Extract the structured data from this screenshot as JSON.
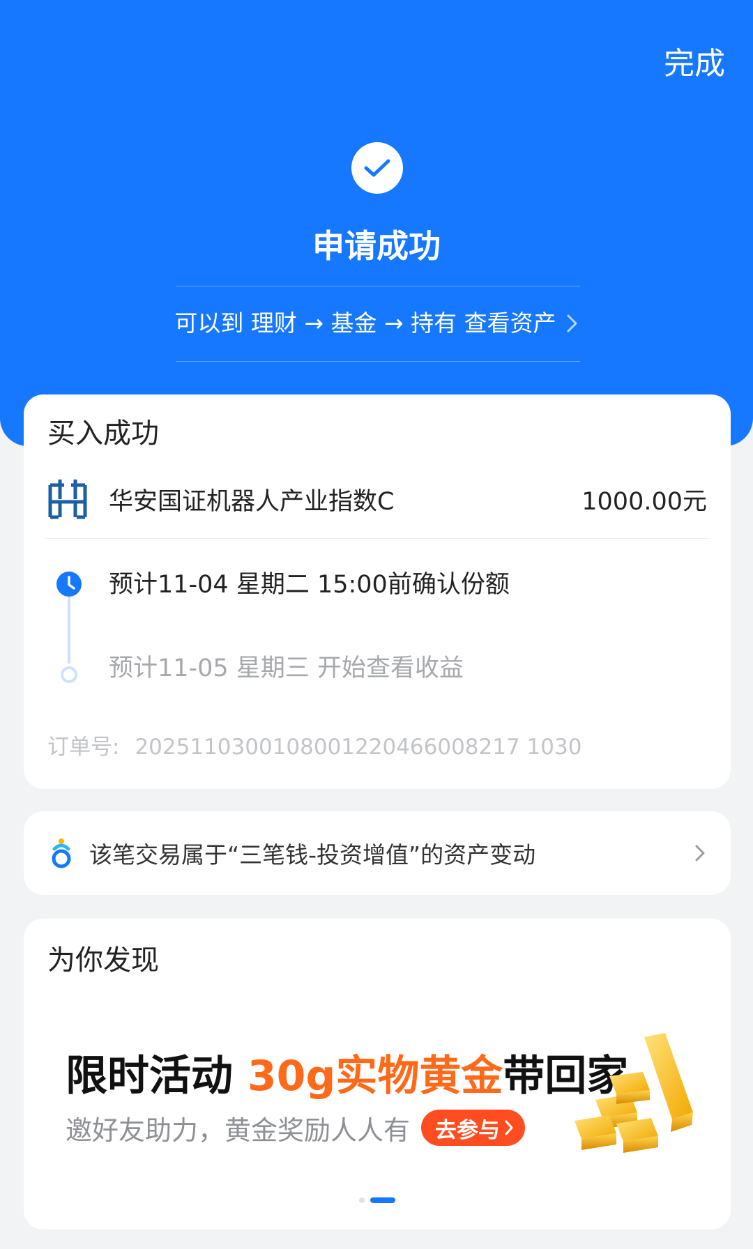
{
  "header": {
    "done_label": "完成",
    "status_title": "申请成功",
    "hint": "可以到 理财 → 基金 → 持有 查看资产",
    "bg_color": "#1677ff"
  },
  "purchase": {
    "title": "买入成功",
    "fund_name": "华安国证机器人产业指数C",
    "amount": "1000.00元",
    "steps": [
      {
        "text": "预计11-04 星期二 15:00前确认份额",
        "state": "active"
      },
      {
        "text": "预计11-05 星期三 开始查看收益",
        "state": "pending"
      }
    ],
    "order_label": "订单号:",
    "order_number": "2025110300108001220466008217 1030"
  },
  "assets_note": {
    "icon": "three-money-icon",
    "text": "该笔交易属于“三笔钱-投资增值”的资产变动"
  },
  "discover": {
    "title": "为你发现",
    "promo_prefix": "限时活动 ",
    "promo_highlight": "30g实物黄金",
    "promo_suffix": "带回家",
    "promo_sub": "邀好友助力，黄金奖励人人有",
    "join_label": "去参与",
    "highlight_color": "#ff6a1a",
    "pager_total": 2,
    "pager_active": 2
  }
}
